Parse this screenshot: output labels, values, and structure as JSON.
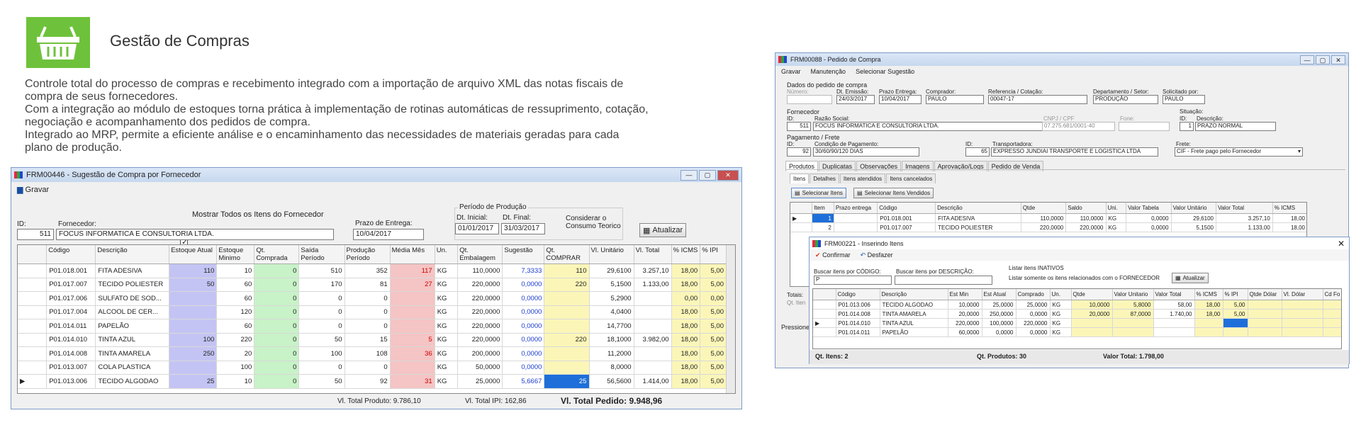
{
  "header": {
    "title": "Gestão de Compras",
    "paragraphs": [
      "Controle total do processo de compras e recebimento integrado com a importação de arquivo XML das notas fiscais de compra de seus fornecedores.",
      "Com a integração ao módulo de estoques torna prática à implementação de rotinas automáticas de ressuprimento, cotação, negociação e acompanhamento dos pedidos de compra.",
      "Integrado ao MRP, permite a eficiente análise e o encaminhamento das necessidades de materiais geradas para cada plano de produção."
    ]
  },
  "colors": {
    "accent_green": "#6ec23b",
    "col_blue": "#c4c4f4",
    "col_green": "#c8f2c8",
    "col_pink": "#f5c4c4",
    "col_yellow": "#fbf6b8"
  },
  "win1": {
    "title": "FRM00446 - Sugestão de Compra por Fornecedor",
    "save": "Gravar",
    "show_all_label": "Mostrar Todos os Itens do Fornecedor",
    "id_label": "ID:",
    "id_value": "511",
    "supplier_label": "Fornecedor:",
    "supplier_value": "FOCUS INFORMATICA E CONSULTORIA LTDA.",
    "deadline_label": "Prazo de Entrega:",
    "deadline_value": "10/04/2017",
    "period_label": "Período de Produção",
    "start_label": "Dt. Inicial:",
    "start_value": "01/01/2017",
    "end_label": "Dt. Final:",
    "end_value": "31/03/2017",
    "consider_label": "Considerar o Consumo Teorico",
    "update": "Atualizar",
    "columns": [
      "",
      "Código",
      "Descrição",
      "Estoque Atual",
      "Estoque Minimo",
      "Qt. Comprada",
      "Saída Período",
      "Produção Período",
      "Média Mês",
      "Un.",
      "Qt. Embalagem",
      "Sugestão",
      "Qt. COMPRAR",
      "Vl. Unitário",
      "Vl. Total",
      "% ICMS",
      "% IPI"
    ],
    "rows": [
      [
        "",
        "P01.018.001",
        "FITA ADESIVA",
        "110",
        "10",
        "0",
        "510",
        "352",
        "117",
        "KG",
        "110,0000",
        "7,3333",
        "110",
        "29,6100",
        "3.257,10",
        "18,00",
        "5,00"
      ],
      [
        "",
        "P01.017.007",
        "TECIDO POLIESTER",
        "50",
        "60",
        "0",
        "170",
        "81",
        "27",
        "KG",
        "220,0000",
        "0,0000",
        "220",
        "5,1500",
        "1.133,00",
        "18,00",
        "5,00"
      ],
      [
        "",
        "P01.017.006",
        "SULFATO DE SOD...",
        "",
        "60",
        "0",
        "0",
        "0",
        "",
        "KG",
        "220,0000",
        "0,0000",
        "",
        "5,2900",
        "",
        "0,00",
        "0,00"
      ],
      [
        "",
        "P01.017.004",
        "ALCOOL DE CER...",
        "",
        "120",
        "0",
        "0",
        "0",
        "",
        "KG",
        "220,0000",
        "0,0000",
        "",
        "4,0400",
        "",
        "18,00",
        "5,00"
      ],
      [
        "",
        "P01.014.011",
        "PAPELÃO",
        "",
        "60",
        "0",
        "0",
        "0",
        "",
        "KG",
        "220,0000",
        "0,0000",
        "",
        "14,7700",
        "",
        "18,00",
        "5,00"
      ],
      [
        "",
        "P01.014.010",
        "TINTA AZUL",
        "100",
        "220",
        "0",
        "50",
        "15",
        "5",
        "KG",
        "220,0000",
        "0,0000",
        "220",
        "18,1000",
        "3.982,00",
        "18,00",
        "5,00"
      ],
      [
        "",
        "P01.014.008",
        "TINTA AMARELA",
        "250",
        "20",
        "0",
        "100",
        "108",
        "36",
        "KG",
        "200,0000",
        "0,0000",
        "",
        "11,2000",
        "",
        "18,00",
        "5,00"
      ],
      [
        "",
        "P01.013.007",
        "COLA PLASTICA",
        "",
        "100",
        "0",
        "0",
        "0",
        "",
        "KG",
        "50,0000",
        "0,0000",
        "",
        "8,0000",
        "",
        "18,00",
        "5,00"
      ],
      [
        "▶",
        "P01.013.006",
        "TECIDO ALGODAO",
        "25",
        "10",
        "0",
        "50",
        "92",
        "31",
        "KG",
        "25,0000",
        "5,6667",
        "25",
        "56,5600",
        "1.414,00",
        "18,00",
        "5,00"
      ]
    ],
    "total_product_label": "Vl. Total Produto:",
    "total_product": "9.786,10",
    "total_ipi_label": "Vl. Total IPI:",
    "total_ipi": "162,86",
    "total_order_label": "Vl. Total Pedido:",
    "total_order": "9.948,96"
  },
  "win2": {
    "title": "FRM00088 - Pedido de Compra",
    "toolbar": [
      "Gravar",
      "Manutenção",
      "Selecionar Sugestão"
    ],
    "section1": "Dados do pedido de compra",
    "fields1": [
      {
        "l": "Número:",
        "v": ""
      },
      {
        "l": "Dt. Emissão:",
        "v": "24/03/2017"
      },
      {
        "l": "Prazo Entrega:",
        "v": "10/04/2017"
      },
      {
        "l": "Comprador:",
        "v": "PAULO"
      },
      {
        "l": "Referencia / Cotação:",
        "v": "00047-17"
      },
      {
        "l": "Departamento / Setor:",
        "v": "PRODUÇÃO"
      },
      {
        "l": "Solicitado por:",
        "v": "PAULO"
      }
    ],
    "section2": "Fornecedor",
    "sit_label": "Situação:",
    "sup_id_label": "ID:",
    "sup_id": "511",
    "razao_label": "Razão Social:",
    "razao": "FOCUS INFORMATICA E CONSULTORIA LTDA.",
    "cnpj_label": "CNPJ / CPF",
    "cnpj": "07.275.681/0001-40",
    "fone_label": "Fone:",
    "sit_id_label": "ID:",
    "sit_id": "1",
    "sit_desc_label": "Descrição:",
    "sit_desc": "PRAZO NORMAL",
    "section3": "Pagamento / Frete",
    "pay_id_label": "ID:",
    "pay_id": "92",
    "cond_label": "Condição de Pagamento:",
    "cond": "30/60/90/120 DIAS",
    "tr_id_label": "ID:",
    "tr_id": "65",
    "trans_label": "Transportadora:",
    "trans": "EXPRESSO JUNDIAI TRANSPORTE E LOGISTICA LTDA",
    "frete_label": "Frete:",
    "frete": "CIF - Frete pago pelo Fornecedor",
    "tabs": [
      "Produtos",
      "Duplicatas",
      "Observações",
      "Imagens",
      "Aprovação/Logs",
      "Pedido de Venda"
    ],
    "subtabs": [
      "Itens",
      "Detalhes",
      "Itens atendidos",
      "Itens cancelados"
    ],
    "sel_items": "Selecionar Itens",
    "sel_sold": "Selecionar Itens Vendidos",
    "columns": [
      "",
      "Item",
      "Prazo entrega",
      "Código",
      "Descrição",
      "Qtde",
      "Saldo",
      "Uni.",
      "Valor Tabela",
      "Valor Unitário",
      "Valor Total",
      "% ICMS"
    ],
    "rows": [
      [
        "▶",
        "1",
        "",
        "P01.018.001",
        "FITA ADESIVA",
        "110,0000",
        "110,0000",
        "KG",
        "0,0000",
        "29,6100",
        "3.257,10",
        "18,00"
      ],
      [
        "",
        "2",
        "",
        "P01.017.007",
        "TECIDO POLIESTER",
        "220,0000",
        "220,0000",
        "KG",
        "0,0000",
        "5,1500",
        "1.133,00",
        "18,00"
      ]
    ],
    "totals_label": "Totais:",
    "qt_label": "Qt. Iten",
    "status": "Pressione"
  },
  "win3": {
    "title": "FRM00221 - Inserindo Itens",
    "confirm": "Confirmar",
    "undo": "Desfazer",
    "search_code_label": "Buscar itens por CÓDIGO:",
    "search_code": "P",
    "search_desc_label": "Buscar itens por DESCRIÇÃO:",
    "search_desc": "",
    "inactive_label": "Listar itens INATIVOS",
    "related_label": "Listar somente os itens relacionados com o FORNECEDOR",
    "update": "Atualizar",
    "columns": [
      "",
      "Código",
      "Descrição",
      "Est Min",
      "Est Atual",
      "Comprado",
      "Un.",
      "Qtde",
      "Valor Unitario",
      "Valor Total",
      "% ICMS",
      "% IPI",
      "Qtde Dólar",
      "Vl. Dólar",
      "Cd Fo"
    ],
    "rows": [
      [
        "",
        "P01.013.006",
        "TECIDO ALGODAO",
        "10,0000",
        "25,0000",
        "25,0000",
        "KG",
        "10,0000",
        "5,8000",
        "58,00",
        "18,00",
        "5,00",
        "",
        "",
        ""
      ],
      [
        "",
        "P01.014.008",
        "TINTA AMARELA",
        "20,0000",
        "250,0000",
        "0,0000",
        "KG",
        "20,0000",
        "87,0000",
        "1.740,00",
        "18,00",
        "5,00",
        "",
        "",
        ""
      ],
      [
        "▶",
        "P01.014.010",
        "TINTA AZUL",
        "220,0000",
        "100,0000",
        "220,0000",
        "KG",
        "",
        "",
        "",
        "",
        "",
        "",
        "",
        ""
      ],
      [
        "",
        "P01.014.011",
        "PAPELÃO",
        "60,0000",
        "0,0000",
        "0,0000",
        "KG",
        "",
        "",
        "",
        "",
        "",
        "",
        "",
        ""
      ]
    ],
    "qt_items_label": "Qt. Itens:",
    "qt_items": "2",
    "qt_prod_label": "Qt. Produtos:",
    "qt_prod": "30",
    "total_label": "Valor Total:",
    "total": "1.798,00"
  }
}
